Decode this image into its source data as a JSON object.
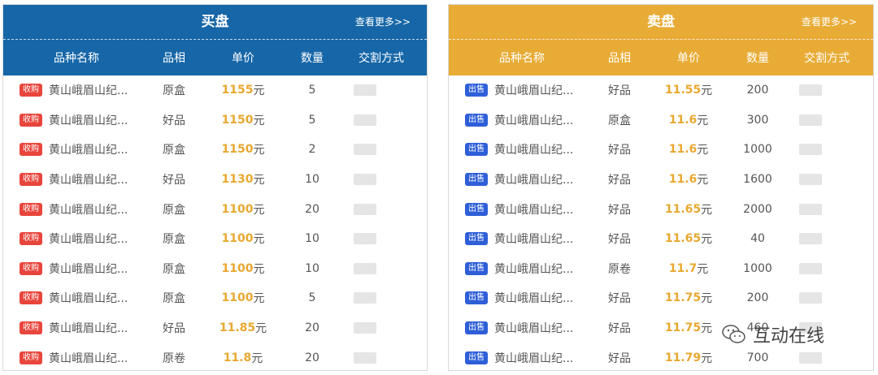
{
  "buy": {
    "title": "买盘",
    "more": "查看更多>>",
    "headers": {
      "name": "品种名称",
      "quality": "品相",
      "price": "单价",
      "qty": "数量",
      "method": "交割方式"
    },
    "tag": "收购",
    "tag_color": "#e8453c",
    "header_color": "#1767a8",
    "rows": [
      {
        "name": "黄山峨眉山纪...",
        "quality": "原盒",
        "price": "1155",
        "unit": "元",
        "qty": "5"
      },
      {
        "name": "黄山峨眉山纪...",
        "quality": "好品",
        "price": "1150",
        "unit": "元",
        "qty": "5"
      },
      {
        "name": "黄山峨眉山纪...",
        "quality": "原盒",
        "price": "1150",
        "unit": "元",
        "qty": "2"
      },
      {
        "name": "黄山峨眉山纪...",
        "quality": "好品",
        "price": "1130",
        "unit": "元",
        "qty": "10"
      },
      {
        "name": "黄山峨眉山纪...",
        "quality": "原盒",
        "price": "1100",
        "unit": "元",
        "qty": "20"
      },
      {
        "name": "黄山峨眉山纪...",
        "quality": "原盒",
        "price": "1100",
        "unit": "元",
        "qty": "10"
      },
      {
        "name": "黄山峨眉山纪...",
        "quality": "原盒",
        "price": "1100",
        "unit": "元",
        "qty": "10"
      },
      {
        "name": "黄山峨眉山纪...",
        "quality": "原盒",
        "price": "1100",
        "unit": "元",
        "qty": "5"
      },
      {
        "name": "黄山峨眉山纪...",
        "quality": "好品",
        "price": "11.85",
        "unit": "元",
        "qty": "20"
      },
      {
        "name": "黄山峨眉山纪...",
        "quality": "原卷",
        "price": "11.8",
        "unit": "元",
        "qty": "20"
      }
    ]
  },
  "sell": {
    "title": "卖盘",
    "more": "查看更多>>",
    "headers": {
      "name": "品种名称",
      "quality": "品相",
      "price": "单价",
      "qty": "数量",
      "method": "交割方式"
    },
    "tag": "出售",
    "tag_color": "#2e5fd8",
    "header_color": "#e8ac36",
    "rows": [
      {
        "name": "黄山峨眉山纪...",
        "quality": "好品",
        "price": "11.55",
        "unit": "元",
        "qty": "200"
      },
      {
        "name": "黄山峨眉山纪...",
        "quality": "原盒",
        "price": "11.6",
        "unit": "元",
        "qty": "300"
      },
      {
        "name": "黄山峨眉山纪...",
        "quality": "好品",
        "price": "11.6",
        "unit": "元",
        "qty": "1000"
      },
      {
        "name": "黄山峨眉山纪...",
        "quality": "好品",
        "price": "11.6",
        "unit": "元",
        "qty": "1600"
      },
      {
        "name": "黄山峨眉山纪...",
        "quality": "好品",
        "price": "11.65",
        "unit": "元",
        "qty": "2000"
      },
      {
        "name": "黄山峨眉山纪...",
        "quality": "好品",
        "price": "11.65",
        "unit": "元",
        "qty": "40"
      },
      {
        "name": "黄山峨眉山纪...",
        "quality": "原卷",
        "price": "11.7",
        "unit": "元",
        "qty": "1000"
      },
      {
        "name": "黄山峨眉山纪...",
        "quality": "好品",
        "price": "11.75",
        "unit": "元",
        "qty": "200"
      },
      {
        "name": "黄山峨眉山纪...",
        "quality": "好品",
        "price": "11.75",
        "unit": "元",
        "qty": "460"
      },
      {
        "name": "黄山峨眉山纪...",
        "quality": "好品",
        "price": "11.79",
        "unit": "元",
        "qty": "700"
      }
    ]
  },
  "watermark": {
    "text": "互动在线",
    "icon": "wechat-icon"
  }
}
